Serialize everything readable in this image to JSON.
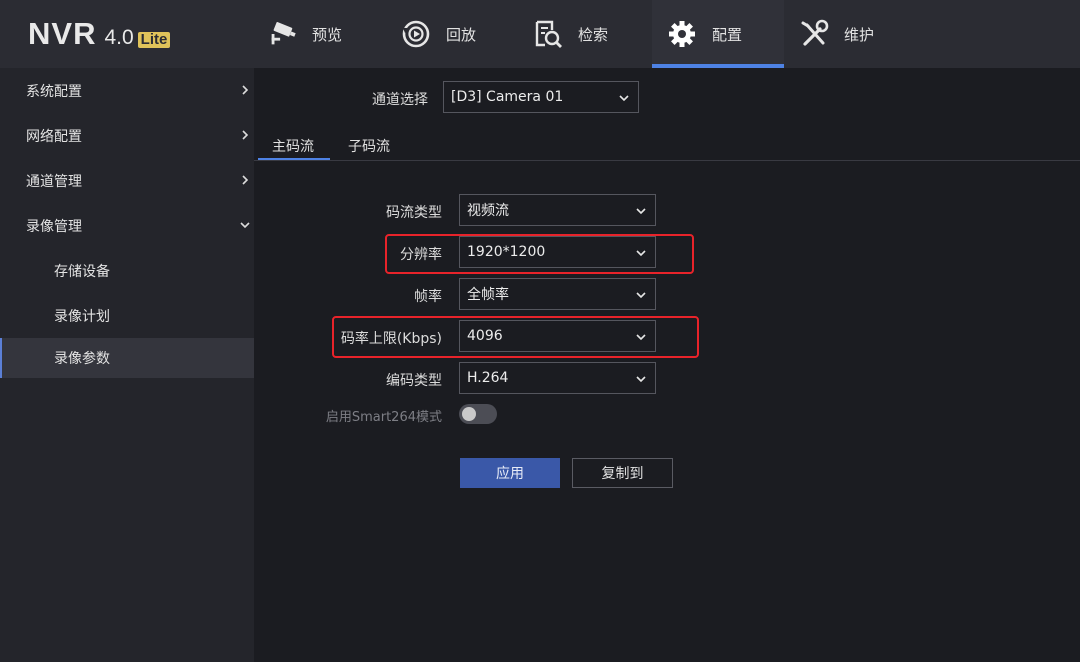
{
  "brand": {
    "name": "NVR",
    "version": "4.0",
    "edition": "Lite"
  },
  "nav": [
    {
      "label": "预览",
      "icon": "camera-icon"
    },
    {
      "label": "回放",
      "icon": "playback-icon"
    },
    {
      "label": "检索",
      "icon": "search-doc-icon"
    },
    {
      "label": "配置",
      "icon": "gear-icon",
      "active": true
    },
    {
      "label": "维护",
      "icon": "tools-icon"
    }
  ],
  "sidebar": {
    "items": [
      {
        "label": "系统配置"
      },
      {
        "label": "网络配置"
      },
      {
        "label": "通道管理"
      },
      {
        "label": "录像管理",
        "expanded": true
      },
      {
        "label": "存储设备"
      },
      {
        "label": "录像计划"
      },
      {
        "label": "录像参数",
        "active": true
      }
    ]
  },
  "channel": {
    "label": "通道选择",
    "value": "[D3] Camera 01"
  },
  "tabs": [
    {
      "label": "主码流",
      "active": true
    },
    {
      "label": "子码流"
    }
  ],
  "form": {
    "stream_type": {
      "label": "码流类型",
      "value": "视频流"
    },
    "resolution": {
      "label": "分辨率",
      "value": "1920*1200"
    },
    "frame_rate": {
      "label": "帧率",
      "value": "全帧率"
    },
    "bitrate_limit": {
      "label": "码率上限(Kbps)",
      "value": "4096"
    },
    "encoding": {
      "label": "编码类型",
      "value": "H.264"
    },
    "smart264": {
      "label": "启用Smart264模式",
      "enabled": false
    }
  },
  "buttons": {
    "apply": "应用",
    "copy_to": "复制到"
  },
  "colors": {
    "accent": "#4e82e4",
    "highlight": "#e8232a",
    "primary_button": "#3a58a8"
  }
}
